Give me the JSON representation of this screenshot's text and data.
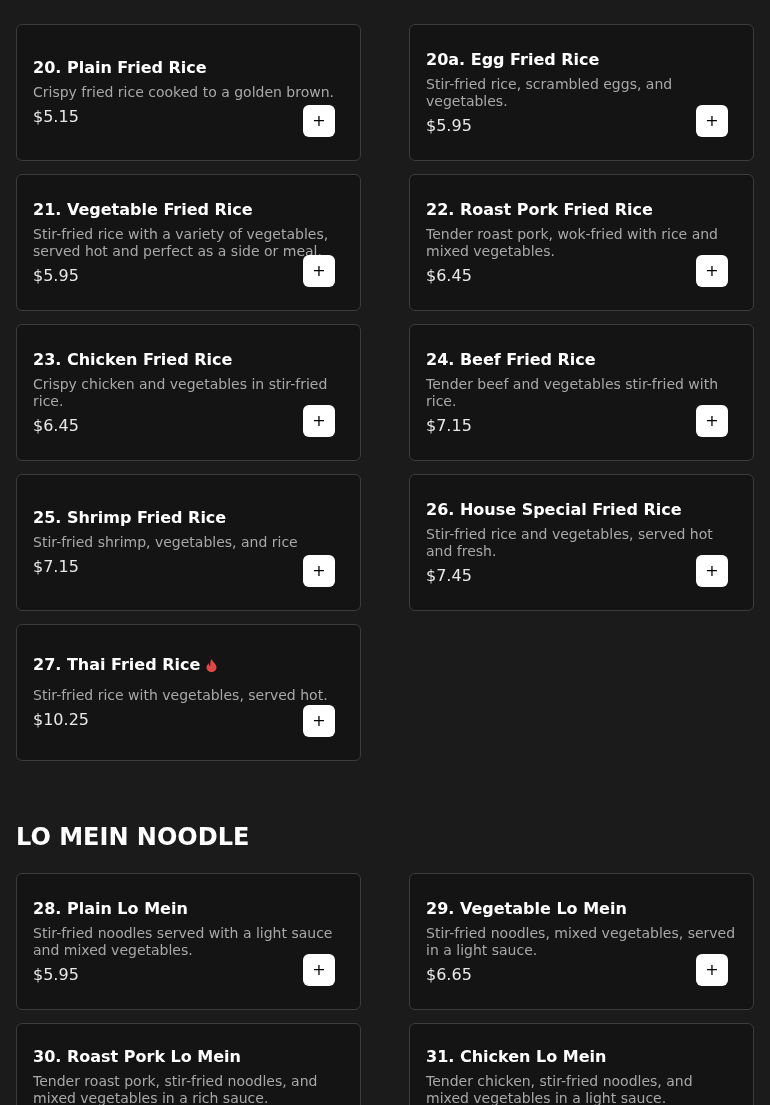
{
  "sections": [
    {
      "items": [
        {
          "title": "20. Plain Fried Rice",
          "description": "Crispy fried rice cooked to a golden brown.",
          "price": "$5.15",
          "spicy": false,
          "add_button": "+"
        },
        {
          "title": "20a. Egg Fried Rice",
          "description": "Stir-fried rice, scrambled eggs, and vegetables.",
          "price": "$5.95",
          "spicy": false,
          "add_button": "+"
        },
        {
          "title": "21. Vegetable Fried Rice",
          "description": "Stir-fried rice with a variety of vegetables, served hot and perfect as a side or meal.",
          "price": "$5.95",
          "spicy": false,
          "add_button": "+"
        },
        {
          "title": "22. Roast Pork Fried Rice",
          "description": "Tender roast pork, wok-fried with rice and mixed vegetables.",
          "price": "$6.45",
          "spicy": false,
          "add_button": "+"
        },
        {
          "title": "23. Chicken Fried Rice",
          "description": "Crispy chicken and vegetables in stir-fried rice.",
          "price": "$6.45",
          "spicy": false,
          "add_button": "+"
        },
        {
          "title": "24. Beef Fried Rice",
          "description": "Tender beef and vegetables stir-fried with rice.",
          "price": "$7.15",
          "spicy": false,
          "add_button": "+"
        },
        {
          "title": "25. Shrimp Fried Rice",
          "description": "Stir-fried shrimp, vegetables, and rice",
          "price": "$7.15",
          "spicy": false,
          "add_button": "+"
        },
        {
          "title": "26. House Special Fried Rice",
          "description": "Stir-fried rice and vegetables, served hot and fresh.",
          "price": "$7.45",
          "spicy": false,
          "add_button": "+"
        },
        {
          "title": "27. Thai Fried Rice",
          "description": "Stir-fried rice with vegetables, served hot.",
          "price": "$10.25",
          "spicy": true,
          "add_button": "+"
        }
      ]
    },
    {
      "heading": "LO MEIN NOODLE",
      "items": [
        {
          "title": "28. Plain Lo Mein",
          "description": "Stir-fried noodles served with a light sauce and mixed vegetables.",
          "price": "$5.95",
          "spicy": false,
          "add_button": "+"
        },
        {
          "title": "29. Vegetable Lo Mein",
          "description": "Stir-fried noodles, mixed vegetables, served in a light sauce.",
          "price": "$6.65",
          "spicy": false,
          "add_button": "+"
        },
        {
          "title": "30. Roast Pork Lo Mein",
          "description": "Tender roast pork, stir-fried noodles, and mixed vegetables in a rich sauce.",
          "spicy": false
        },
        {
          "title": "31. Chicken Lo Mein",
          "description": "Tender chicken, stir-fried noodles, and mixed vegetables in a light sauce.",
          "spicy": false
        }
      ]
    }
  ]
}
